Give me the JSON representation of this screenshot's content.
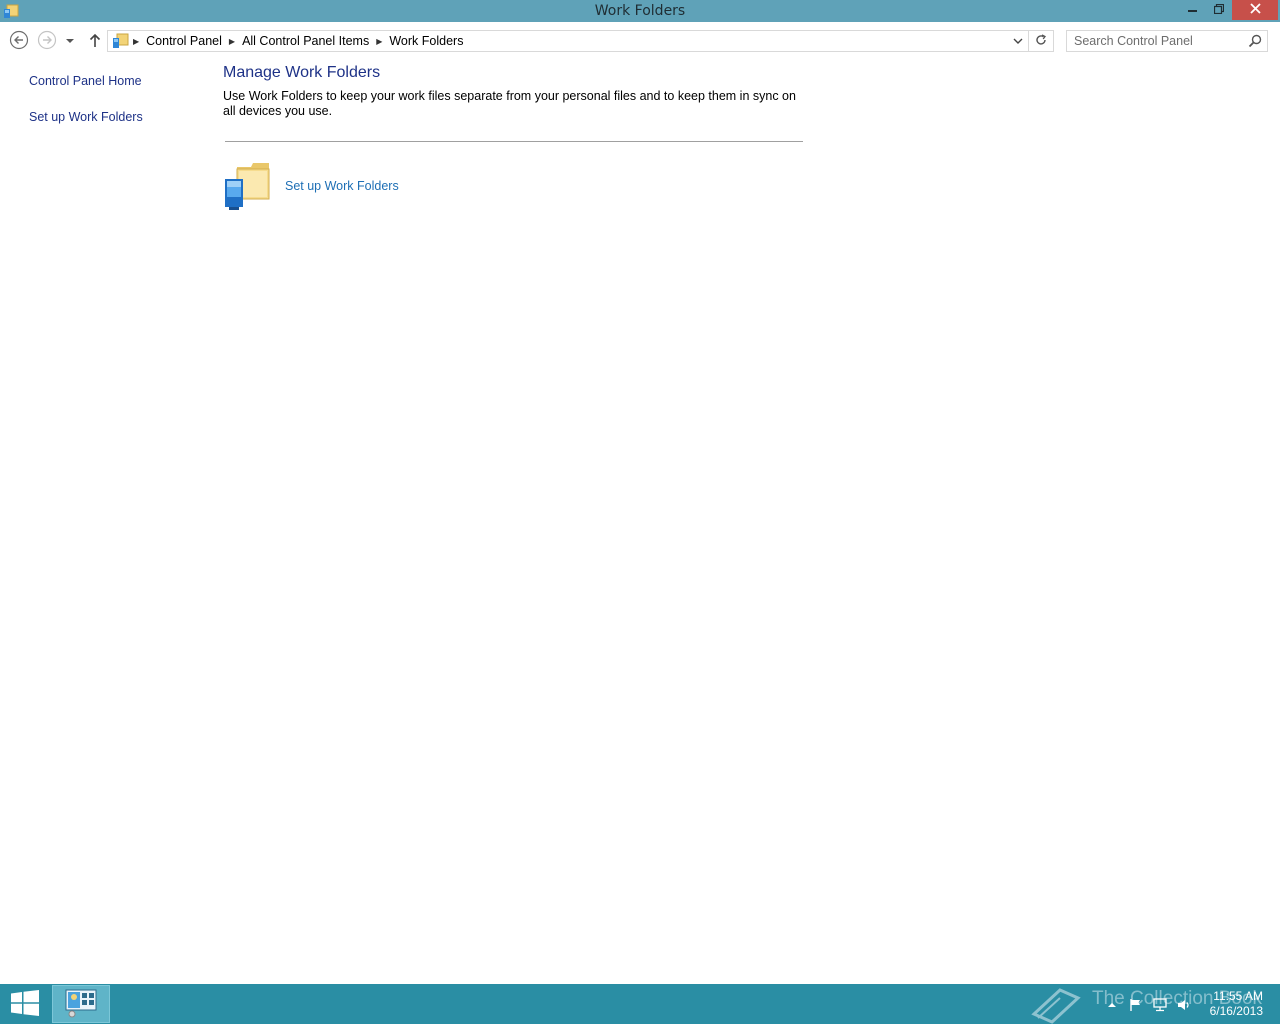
{
  "window": {
    "title": "Work Folders",
    "minimize_icon": "minimize-icon",
    "maximize_icon": "restore-icon",
    "close_icon": "close-icon"
  },
  "navigation": {
    "breadcrumbs": [
      "Control Panel",
      "All Control Panel Items",
      "Work Folders"
    ],
    "search_placeholder": "Search Control Panel"
  },
  "sidebar": {
    "items": [
      {
        "label": "Control Panel Home"
      },
      {
        "label": "Set up Work Folders"
      }
    ]
  },
  "main": {
    "heading": "Manage Work Folders",
    "description": "Use Work Folders to keep your work files separate from your personal files and to keep them in sync on all devices you use.",
    "task_link": "Set up Work Folders"
  },
  "taskbar": {
    "watermark": "The Collection Book",
    "time": "11:55 AM",
    "date": "6/16/2013"
  },
  "colors": {
    "titlebar": "#5fa2b8",
    "close_button": "#c7504a",
    "link": "#1e3287",
    "task_link": "#1e6fb5",
    "taskbar": "#2a8ea4"
  }
}
